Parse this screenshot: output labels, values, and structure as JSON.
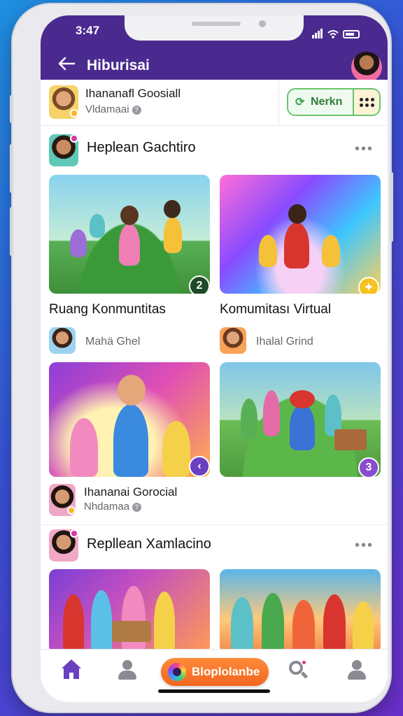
{
  "status": {
    "time": "3:47"
  },
  "appbar": {
    "back_icon": "arrow-left-icon",
    "title": "Hiburisai"
  },
  "profile": {
    "name": "Ihananafl Goosiall",
    "subtitle": "Vldamaai",
    "follow_label": "Nerkn"
  },
  "sections": [
    {
      "title": "Heplean Gachtiro",
      "cards": [
        {
          "title": "Ruang Konmuntitas",
          "badge": "2",
          "creator": "Mahä Ghel"
        },
        {
          "title": "Komumitası Virtual",
          "creator": "Ihalal Grind"
        }
      ]
    },
    {
      "cards": [
        {
          "badge": "‹"
        },
        {
          "badge": "3"
        }
      ],
      "creator_name": "Ihananai Gorocial",
      "creator_subtitle": "Nhdamaa"
    },
    {
      "title": "Repllean Xamlacino"
    }
  ],
  "bottom_nav": {
    "items": [
      "home",
      "profile",
      "cta",
      "search",
      "account"
    ],
    "cta_label": "Bloplolanbe"
  },
  "colors": {
    "header": "#4a2a8e",
    "accent_green": "#69c46f",
    "cta_orange": "#f2661f",
    "nav_active": "#6a3fc0"
  }
}
